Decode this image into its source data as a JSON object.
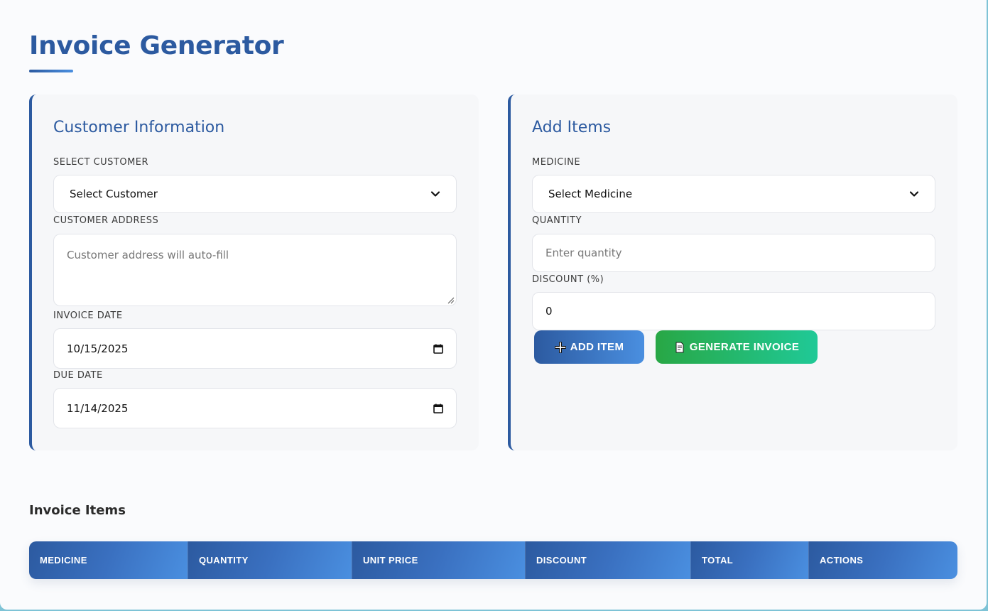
{
  "header": {
    "title": "Invoice Generator"
  },
  "customer_card": {
    "title": "Customer Information",
    "select_customer_label": "SELECT CUSTOMER",
    "select_customer_value": "Select Customer",
    "address_label": "CUSTOMER ADDRESS",
    "address_placeholder": "Customer address will auto-fill",
    "invoice_date_label": "INVOICE DATE",
    "invoice_date_value": "10/15/2025",
    "due_date_label": "DUE DATE",
    "due_date_value": "11/14/2025"
  },
  "items_card": {
    "title": "Add Items",
    "medicine_label": "MEDICINE",
    "medicine_value": "Select Medicine",
    "quantity_label": "QUANTITY",
    "quantity_placeholder": "Enter quantity",
    "discount_label": "DISCOUNT (%)",
    "discount_value": "0",
    "add_item_label": "ADD ITEM",
    "add_item_icon": "plus-icon",
    "generate_label": "GENERATE INVOICE",
    "generate_icon": "document-icon"
  },
  "invoice_items": {
    "title": "Invoice Items",
    "columns": [
      "MEDICINE",
      "QUANTITY",
      "UNIT PRICE",
      "DISCOUNT",
      "TOTAL",
      "ACTIONS"
    ]
  },
  "colors": {
    "primary": "#2c5aa0",
    "primary_light": "#4a8fe0",
    "success": "#28a745",
    "success_light": "#20c997"
  }
}
